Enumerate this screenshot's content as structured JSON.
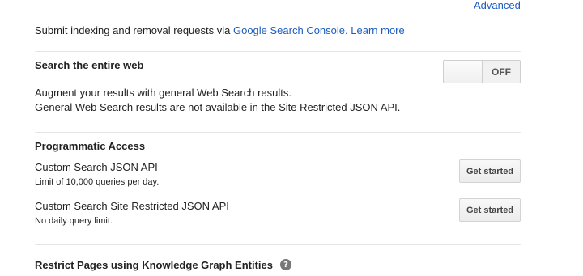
{
  "header": {
    "advanced_link": "Advanced"
  },
  "indexing": {
    "text": "Submit indexing and removal requests via",
    "console_link": "Google Search Console.",
    "learn_more": "Learn more"
  },
  "search_web": {
    "title": "Search the entire web",
    "toggle_state": "OFF",
    "desc_1": "Augment your results with general Web Search results.",
    "desc_2": "General Web Search results are not available in the Site Restricted JSON API."
  },
  "programmatic": {
    "title": "Programmatic Access",
    "apis": [
      {
        "name": "Custom Search JSON API",
        "note": "Limit of 10,000 queries per day.",
        "button": "Get started"
      },
      {
        "name": "Custom Search Site Restricted JSON API",
        "note": "No daily query limit.",
        "button": "Get started"
      }
    ]
  },
  "knowledge_graph": {
    "title": "Restrict Pages using Knowledge Graph Entities",
    "help_icon": "question-mark-icon",
    "help_glyph": "?"
  }
}
